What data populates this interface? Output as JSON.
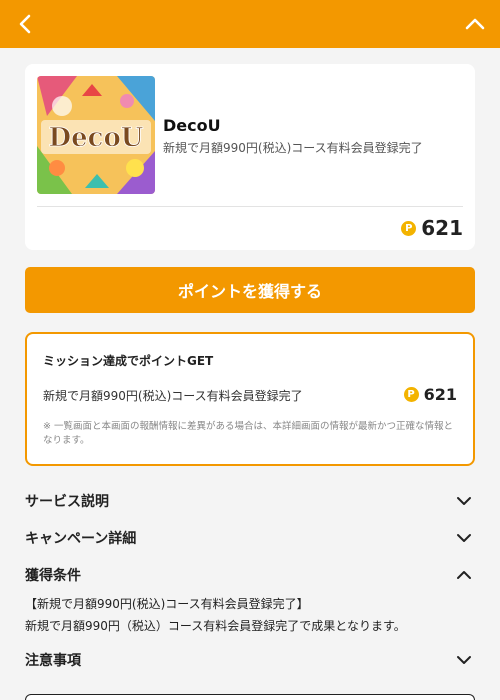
{
  "header": {
    "back_icon": "chevron-left-icon",
    "collapse_icon": "chevron-up-icon",
    "color": "#f39800"
  },
  "app": {
    "thumbnail_text": "DecoU",
    "name": "DecoU",
    "description": "新規で月額990円(税込)コース有料会員登録完了",
    "point_symbol": "P",
    "points": "621"
  },
  "cta": {
    "label": "ポイントを獲得する"
  },
  "mission": {
    "title": "ミッション達成でポイントGET",
    "text": "新規で月額990円(税込)コース有料会員登録完了",
    "point_symbol": "P",
    "points": "621",
    "note": "※ 一覧画面と本画面の報酬情報に差異がある場合は、本詳細画面の情報が最新かつ正確な情報となります。"
  },
  "sections": {
    "service": "サービス説明",
    "campaign": "キャンペーン詳細",
    "conditions": "獲得条件",
    "conditions_line1": "【新規で月額990円(税込)コース有料会員登録完了】",
    "conditions_line2": "新規で月額990円（税込）コース有料会員登録完了で成果となります。",
    "notes": "注意事項"
  },
  "colors": {
    "accent": "#f39800",
    "coin": "#f3b300"
  }
}
